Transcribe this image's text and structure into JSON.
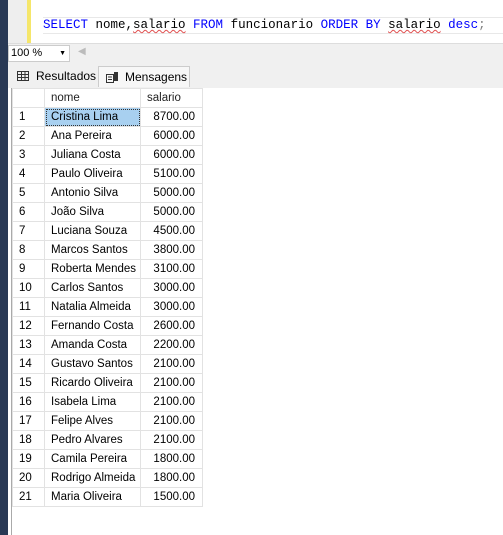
{
  "editor": {
    "keyword_select": "SELECT",
    "fields": " nome,",
    "field_salario": "salario",
    "keyword_from": " FROM",
    "table": " funcionario",
    "keyword_order": " ORDER BY",
    "order_field": "salario",
    "keyword_desc": " desc",
    "end": ";"
  },
  "zoom": {
    "value": "100 %"
  },
  "tabs": [
    {
      "label": "Resultados",
      "icon": "grid-icon"
    },
    {
      "label": "Mensagens",
      "icon": "messages-icon"
    }
  ],
  "grid": {
    "columns": [
      "",
      "nome",
      "salario"
    ],
    "rows": [
      [
        "1",
        "Cristina Lima",
        "8700.00"
      ],
      [
        "2",
        "Ana Pereira",
        "6000.00"
      ],
      [
        "3",
        "Juliana Costa",
        "6000.00"
      ],
      [
        "4",
        "Paulo Oliveira",
        "5100.00"
      ],
      [
        "5",
        "Antonio Silva",
        "5000.00"
      ],
      [
        "6",
        "João Silva",
        "5000.00"
      ],
      [
        "7",
        "Luciana Souza",
        "4500.00"
      ],
      [
        "8",
        "Marcos Santos",
        "3800.00"
      ],
      [
        "9",
        "Roberta Mendes",
        "3100.00"
      ],
      [
        "10",
        "Carlos Santos",
        "3000.00"
      ],
      [
        "11",
        "Natalia Almeida",
        "3000.00"
      ],
      [
        "12",
        "Fernando Costa",
        "2600.00"
      ],
      [
        "13",
        "Amanda Costa",
        "2200.00"
      ],
      [
        "14",
        "Gustavo Santos",
        "2100.00"
      ],
      [
        "15",
        "Ricardo Oliveira",
        "2100.00"
      ],
      [
        "16",
        "Isabela Lima",
        "2100.00"
      ],
      [
        "17",
        "Felipe Alves",
        "2100.00"
      ],
      [
        "18",
        "Pedro Alvares",
        "2100.00"
      ],
      [
        "19",
        "Camila Pereira",
        "1800.00"
      ],
      [
        "20",
        "Rodrigo Almeida",
        "1800.00"
      ],
      [
        "21",
        "Maria Oliveira",
        "1500.00"
      ]
    ]
  }
}
